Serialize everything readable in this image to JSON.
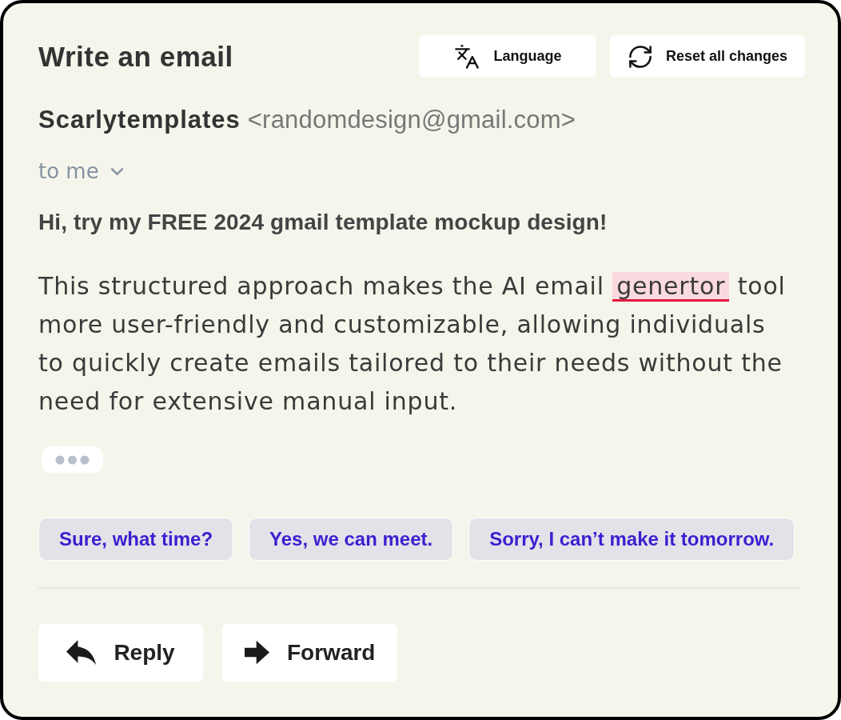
{
  "header": {
    "title": "Write an email",
    "buttons": [
      {
        "kind": "language",
        "label": "Language"
      },
      {
        "kind": "reset",
        "label": "Reset all changes"
      }
    ]
  },
  "sender": {
    "name": "Scarlytemplates",
    "address": "<randomdesign@gmail.com>"
  },
  "recipient": {
    "label": "to me",
    "expanded": false
  },
  "subject": "Hi, try my FREE 2024 gmail template mockup design!",
  "body": [
    {
      "text": "This structured approach makes the AI email ",
      "misspelled": false
    },
    {
      "text": "genertor",
      "misspelled": true
    },
    {
      "text": " tool more user-friendly and customizable, allowing individuals to quickly create emails tailored to their needs without the need for extensive manual input.",
      "misspelled": false
    }
  ],
  "suggestions": [
    "Sure, what time?",
    "Yes, we can meet.",
    "Sorry, I can’t make it tomorrow."
  ],
  "actions": [
    {
      "kind": "reply",
      "label": "Reply"
    },
    {
      "kind": "forward",
      "label": "Forward"
    }
  ]
}
